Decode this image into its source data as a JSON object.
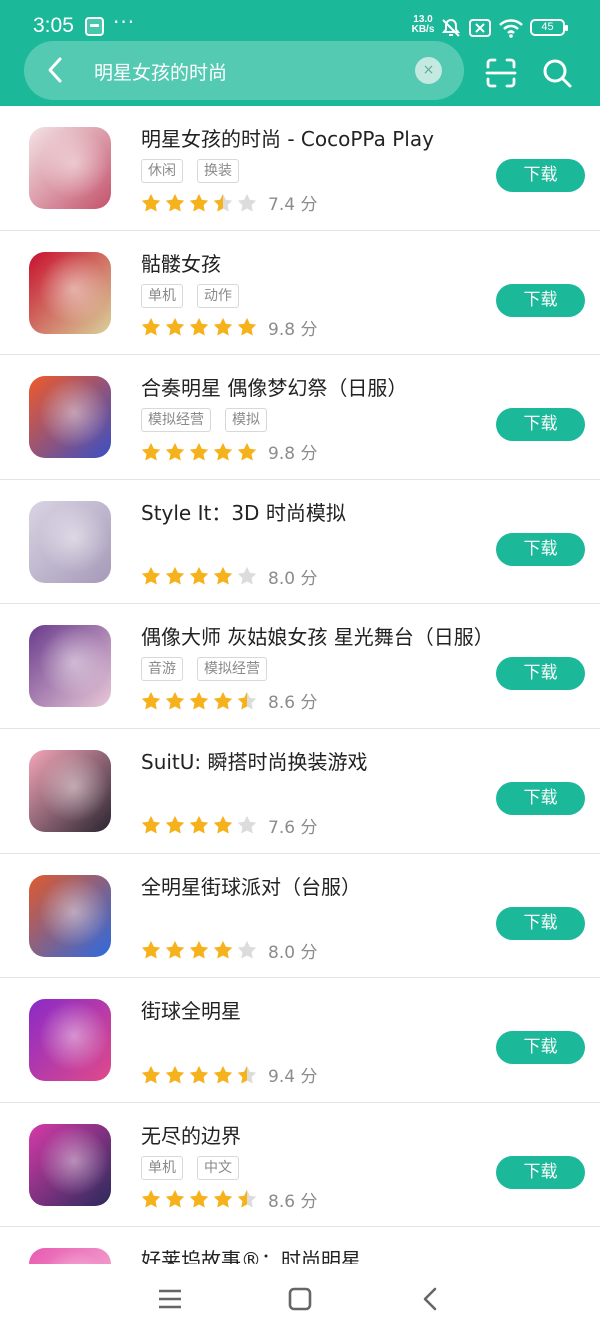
{
  "status_bar": {
    "time": "3:05",
    "dots": "···",
    "net_speed_value": "13.0",
    "net_speed_unit": "KB/s",
    "battery": "45",
    "icons": [
      "mute-icon",
      "no-sim-icon",
      "wifi-icon",
      "battery-icon"
    ]
  },
  "search": {
    "query": "明星女孩的时尚",
    "clear_label": "×"
  },
  "apps": [
    {
      "name": "明星女孩的时尚 - CocoPPa Play",
      "tags": [
        "休闲",
        "换装"
      ],
      "rating": 3.5,
      "score_text": "7.4 分",
      "button": "下载",
      "icon_colors": [
        "#f3e4e6",
        "#c4526b"
      ]
    },
    {
      "name": "骷髅女孩",
      "tags": [
        "单机",
        "动作"
      ],
      "rating": 5,
      "score_text": "9.8 分",
      "button": "下载",
      "icon_colors": [
        "#c8102e",
        "#d9d19a"
      ]
    },
    {
      "name": "合奏明星 偶像梦幻祭（日服）",
      "tags": [
        "模拟经营",
        "模拟"
      ],
      "rating": 5,
      "score_text": "9.8 分",
      "button": "下载",
      "icon_colors": [
        "#f05a2a",
        "#3a4fc4"
      ]
    },
    {
      "name": "Style It：3D 时尚模拟",
      "tags": [],
      "rating": 4,
      "score_text": "8.0 分",
      "button": "下载",
      "icon_colors": [
        "#d9d4e4",
        "#a69ab8"
      ]
    },
    {
      "name": "偶像大师 灰姑娘女孩 星光舞台（日服）",
      "tags": [
        "音游",
        "模拟经营"
      ],
      "rating": 4.5,
      "score_text": "8.6 分",
      "button": "下载",
      "icon_colors": [
        "#6a3c8c",
        "#e8c8d8"
      ]
    },
    {
      "name": "SuitU: 瞬搭时尚换装游戏",
      "tags": [],
      "rating": 4,
      "score_text": "7.6 分",
      "button": "下载",
      "icon_colors": [
        "#f4a6b8",
        "#2a2430"
      ]
    },
    {
      "name": "全明星街球派对（台服）",
      "tags": [],
      "rating": 4,
      "score_text": "8.0 分",
      "button": "下载",
      "icon_colors": [
        "#e05a2c",
        "#2c6ae0"
      ]
    },
    {
      "name": "街球全明星",
      "tags": [],
      "rating": 4.5,
      "score_text": "9.4 分",
      "button": "下载",
      "icon_colors": [
        "#8a2ac8",
        "#e04a8a"
      ]
    },
    {
      "name": "无尽的边界",
      "tags": [
        "单机",
        "中文"
      ],
      "rating": 4.5,
      "score_text": "8.6 分",
      "button": "下载",
      "icon_colors": [
        "#d63aa8",
        "#2a2a5a"
      ]
    },
    {
      "name": "好莱坞故事®：时尚明星",
      "tags": [],
      "rating": 0,
      "score_text": "",
      "button": "",
      "icon_colors": [
        "#e85ab0",
        "#f7c0dc"
      ]
    }
  ],
  "colors": {
    "accent": "#1bb89a",
    "star_filled": "#f6b21c",
    "star_empty": "#dcdcdc"
  }
}
